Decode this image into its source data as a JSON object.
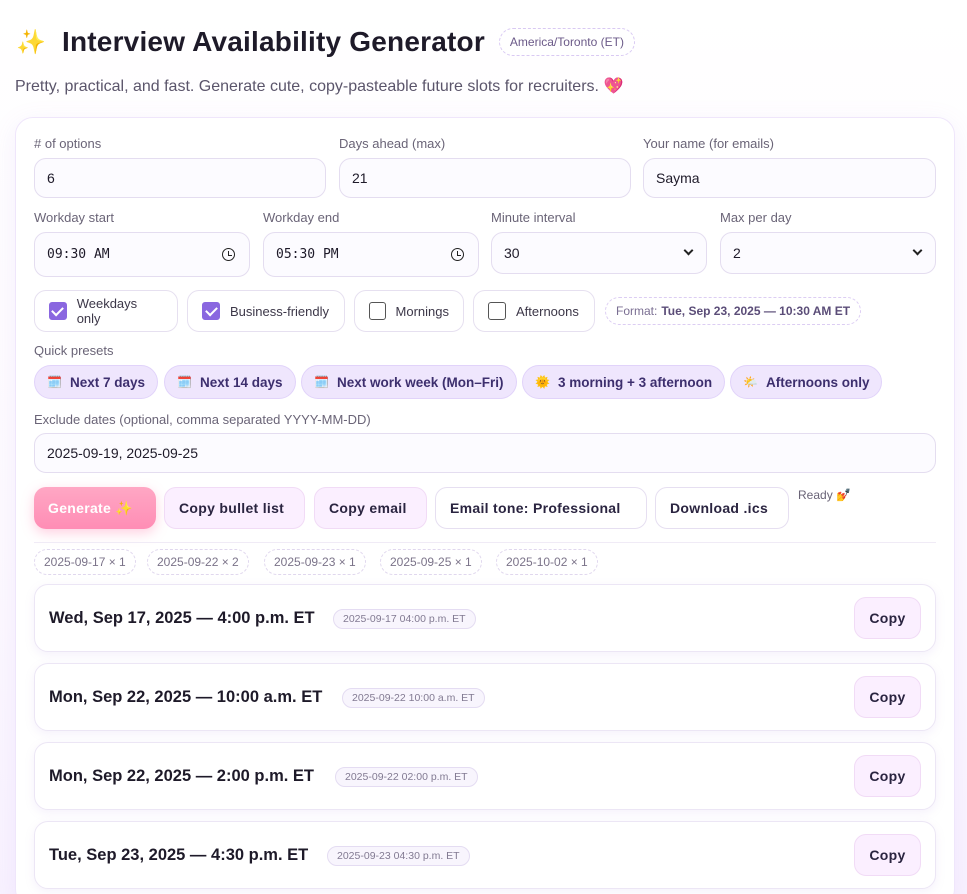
{
  "header": {
    "icon": "sparkles-icon",
    "title": "Interview Availability Generator",
    "timezone": "America/Toronto (ET)",
    "subtitle": "Pretty, practical, and fast. Generate cute, copy-pasteable future slots for recruiters.",
    "subtitle_icon": "heart-icon"
  },
  "form": {
    "options_label": "# of options",
    "options_value": "6",
    "days_ahead_label": "Days ahead (max)",
    "days_ahead_value": "21",
    "name_label": "Your name (for emails)",
    "name_value": "Sayma",
    "workday_start_label": "Workday start",
    "workday_start_value": "09:30 AM",
    "workday_end_label": "Workday end",
    "workday_end_value": "05:30 PM",
    "interval_label": "Minute interval",
    "interval_value": "30",
    "max_per_day_label": "Max per day",
    "max_per_day_value": "2"
  },
  "toggles": [
    {
      "label": "Weekdays only",
      "checked": true
    },
    {
      "label": "Business-friendly",
      "checked": true
    },
    {
      "label": "Mornings",
      "checked": false
    },
    {
      "label": "Afternoons",
      "checked": false
    }
  ],
  "format": {
    "prefix": "Format:",
    "example": "Tue, Sep 23, 2025 — 10:30 AM ET"
  },
  "presets": {
    "label": "Quick presets",
    "items": [
      {
        "icon": "🗓️",
        "label": "Next 7 days"
      },
      {
        "icon": "🗓️",
        "label": "Next 14 days"
      },
      {
        "icon": "🗓️",
        "label": "Next work week (Mon–Fri)"
      },
      {
        "icon": "🌞",
        "label": "3 morning + 3 afternoon"
      },
      {
        "icon": "🌤️",
        "label": "Afternoons only"
      }
    ]
  },
  "exclude": {
    "label": "Exclude dates (optional, comma separated YYYY-MM-DD)",
    "value": "2025-09-19, 2025-09-25"
  },
  "actions": {
    "generate": "Generate ✨",
    "copy_bullets": "Copy bullet list",
    "copy_email": "Copy email",
    "email_tone": "Email tone: Professional",
    "download_ics": "Download .ics",
    "status": "Ready 💅"
  },
  "date_chips": [
    "2025-09-17 × 1",
    "2025-09-22 × 2",
    "2025-09-23 × 1",
    "2025-09-25 × 1",
    "2025-10-02 × 1"
  ],
  "slots": [
    {
      "text": "Wed, Sep 17, 2025 — 4:00 p.m. ET",
      "tag": "2025-09-17 04:00 p.m. ET",
      "copy": "Copy"
    },
    {
      "text": "Mon, Sep 22, 2025 — 10:00 a.m. ET",
      "tag": "2025-09-22 10:00 a.m. ET",
      "copy": "Copy"
    },
    {
      "text": "Mon, Sep 22, 2025 — 2:00 p.m. ET",
      "tag": "2025-09-22 02:00 p.m. ET",
      "copy": "Copy"
    },
    {
      "text": "Tue, Sep 23, 2025 — 4:30 p.m. ET",
      "tag": "2025-09-23 04:30 p.m. ET",
      "copy": "Copy"
    }
  ],
  "colors": {
    "accent": "#8a67e0",
    "generate": "#ff8db5",
    "preset_bg": "#efe6fd"
  }
}
